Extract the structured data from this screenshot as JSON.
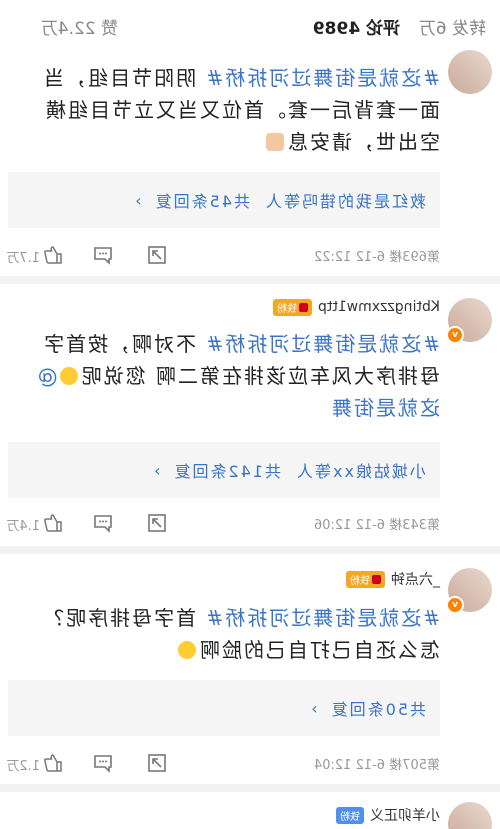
{
  "tabs": {
    "likes_label": "赞 22.4万",
    "comments_label": "评论 4989",
    "reposts_label": "转发 6万"
  },
  "comments": [
    {
      "author": "",
      "fans_badge": "",
      "tag": "#这就是街舞过河拆桥#",
      "text": " 阴阳节目组，当面一套背后一套。首位又当又立节目组横空出世，请安息",
      "reply_preview": "救红是我的错吗等人",
      "reply_count": "共45条回复",
      "floor_time": "第693楼 6-12 12:22",
      "likes": "1.7万"
    },
    {
      "author": "Kbtingzzxmw1ttp",
      "fans_badge": "铁粉",
      "tag": "#这就是街舞过河拆桥#",
      "text": " 不对啊，按首字母排序大风车应该排在第二啊 您说呢",
      "mention": "@这就是街舞",
      "reply_preview": "小城姑娘xx等人",
      "reply_count": "共142条回复",
      "floor_time": "第343楼 6-12 12:06",
      "likes": "1.4万"
    },
    {
      "author": "_六点钟",
      "fans_badge": "铁粉",
      "tag": "#这就是街舞过河拆桥#",
      "text": " 首字母排序呢？怎么还自己打自己的脸啊",
      "reply_preview": "",
      "reply_count": "共50条回复",
      "floor_time": "第507楼 6-12 12:04",
      "likes": "1.2万"
    },
    {
      "author": "小羊卯正义",
      "fans_badge": "铁粉"
    }
  ],
  "icons": {
    "repost": "repost-icon",
    "comment": "comment-icon",
    "like": "thumbs-up-icon"
  },
  "colors": {
    "accent": "#ff8200",
    "link": "#3a74c9",
    "meta": "#999999",
    "badge": "#f5a623"
  }
}
